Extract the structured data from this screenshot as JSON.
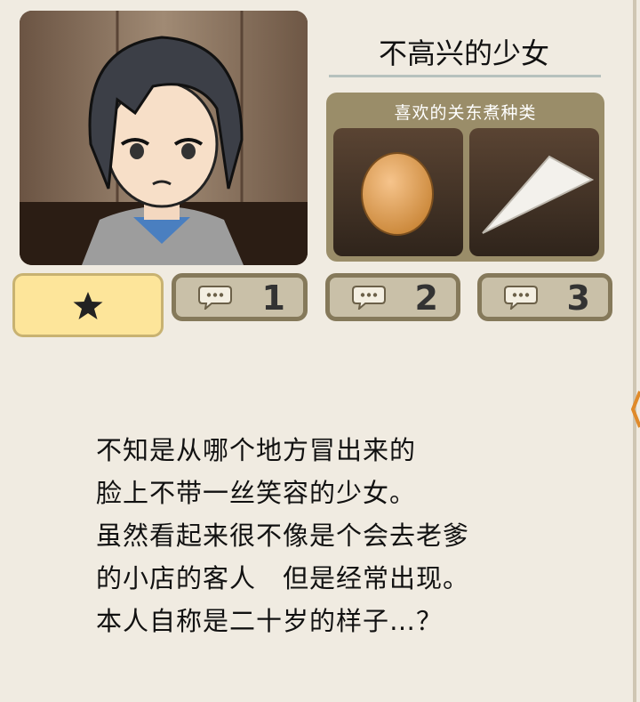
{
  "character": {
    "name": "不高兴的少女"
  },
  "favorites": {
    "label": "喜欢的关东煮种类",
    "items": [
      {
        "icon": "egg-icon"
      },
      {
        "icon": "hanpen-icon"
      }
    ]
  },
  "tabs": [
    {
      "icon": "star-icon",
      "selected": true
    },
    {
      "icon": "speech-bubble-icon",
      "number": "1"
    },
    {
      "icon": "speech-bubble-icon",
      "number": "2"
    },
    {
      "icon": "speech-bubble-icon",
      "number": "3"
    }
  ],
  "description": {
    "lines": [
      "不知是从哪个地方冒出来的",
      "脸上不带一丝笑容的少女。",
      "虽然看起来很不像是个会去老爹",
      "的小店的客人　但是经常出现。",
      "本人自称是二十岁的样子…？"
    ]
  },
  "colors": {
    "background": "#f0ebe1",
    "panel": "#9a8d69",
    "selected_tab": "#fde59a",
    "tab": "#c9c0a8"
  }
}
